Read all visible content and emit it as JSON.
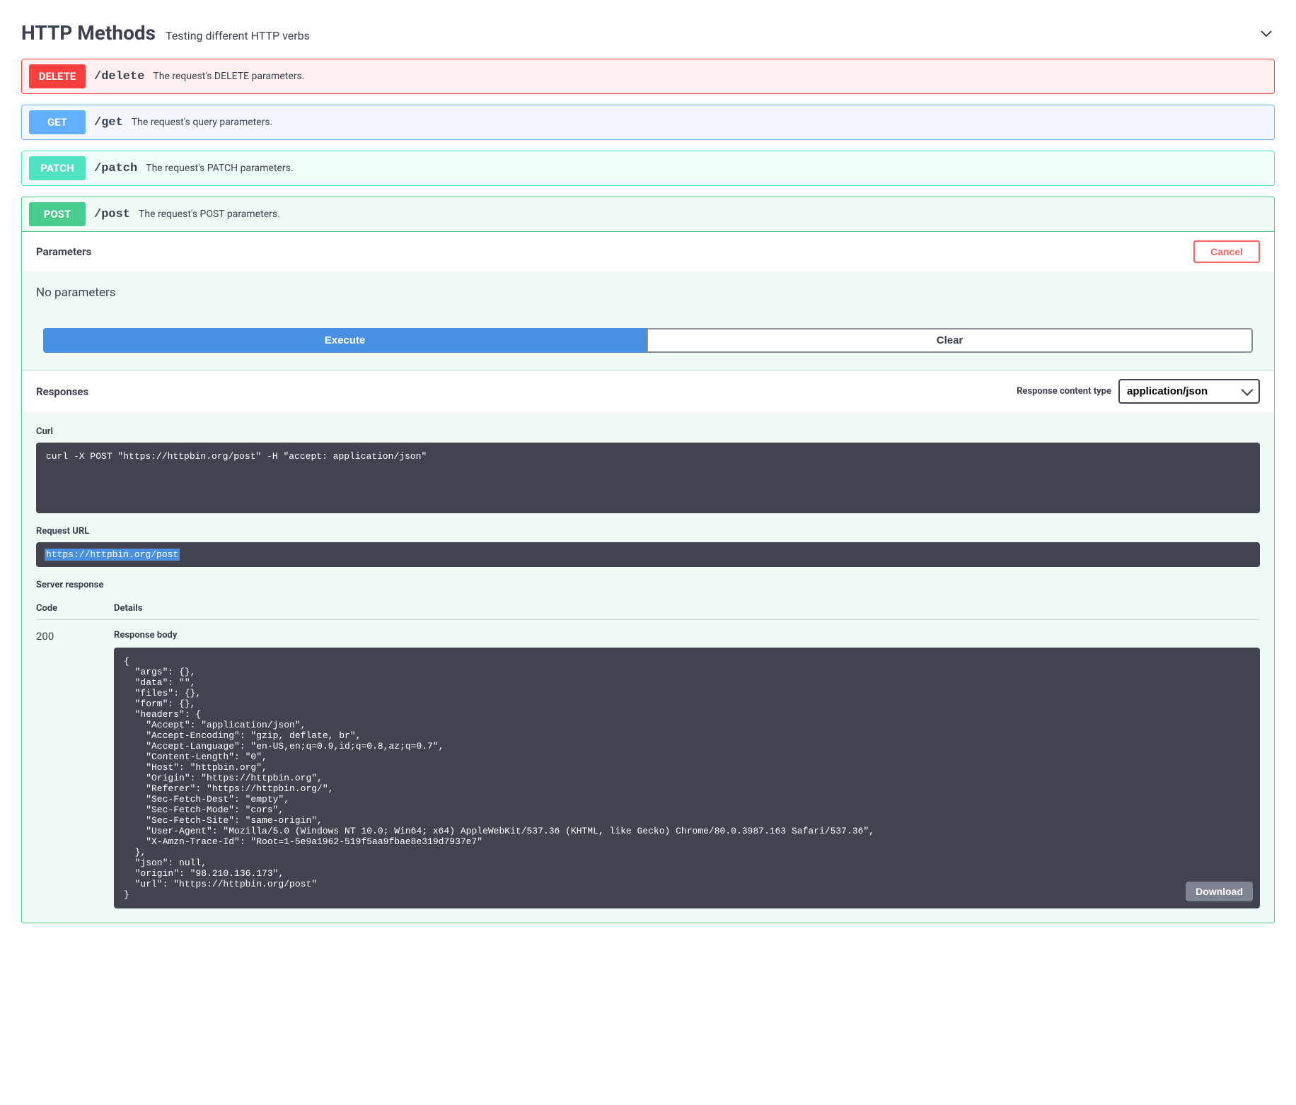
{
  "section": {
    "title": "HTTP Methods",
    "description": "Testing different HTTP verbs"
  },
  "endpoints": {
    "delete": {
      "method": "DELETE",
      "path": "/delete",
      "desc": "The request's DELETE parameters."
    },
    "get": {
      "method": "GET",
      "path": "/get",
      "desc": "The request's query parameters."
    },
    "patch": {
      "method": "PATCH",
      "path": "/patch",
      "desc": "The request's PATCH parameters."
    },
    "post": {
      "method": "POST",
      "path": "/post",
      "desc": "The request's POST parameters."
    }
  },
  "params_panel": {
    "title": "Parameters",
    "cancel": "Cancel",
    "no_params": "No parameters",
    "execute": "Execute",
    "clear": "Clear"
  },
  "responses_panel": {
    "title": "Responses",
    "content_type_label": "Response content type",
    "content_type_value": "application/json"
  },
  "curl": {
    "label": "Curl",
    "command": "curl -X POST \"https://httpbin.org/post\" -H \"accept: application/json\""
  },
  "request_url": {
    "label": "Request URL",
    "value": "https://httpbin.org/post"
  },
  "server_response": {
    "label": "Server response",
    "code_header": "Code",
    "details_header": "Details",
    "code": "200",
    "body_label": "Response body",
    "download": "Download",
    "body": "{\n  \"args\": {}, \n  \"data\": \"\", \n  \"files\": {}, \n  \"form\": {}, \n  \"headers\": {\n    \"Accept\": \"application/json\", \n    \"Accept-Encoding\": \"gzip, deflate, br\", \n    \"Accept-Language\": \"en-US,en;q=0.9,id;q=0.8,az;q=0.7\", \n    \"Content-Length\": \"0\", \n    \"Host\": \"httpbin.org\", \n    \"Origin\": \"https://httpbin.org\", \n    \"Referer\": \"https://httpbin.org/\", \n    \"Sec-Fetch-Dest\": \"empty\", \n    \"Sec-Fetch-Mode\": \"cors\", \n    \"Sec-Fetch-Site\": \"same-origin\", \n    \"User-Agent\": \"Mozilla/5.0 (Windows NT 10.0; Win64; x64) AppleWebKit/537.36 (KHTML, like Gecko) Chrome/80.0.3987.163 Safari/537.36\", \n    \"X-Amzn-Trace-Id\": \"Root=1-5e9a1962-519f5aa9fbae8e319d7937e7\"\n  }, \n  \"json\": null, \n  \"origin\": \"98.210.136.173\", \n  \"url\": \"https://httpbin.org/post\"\n}"
  }
}
